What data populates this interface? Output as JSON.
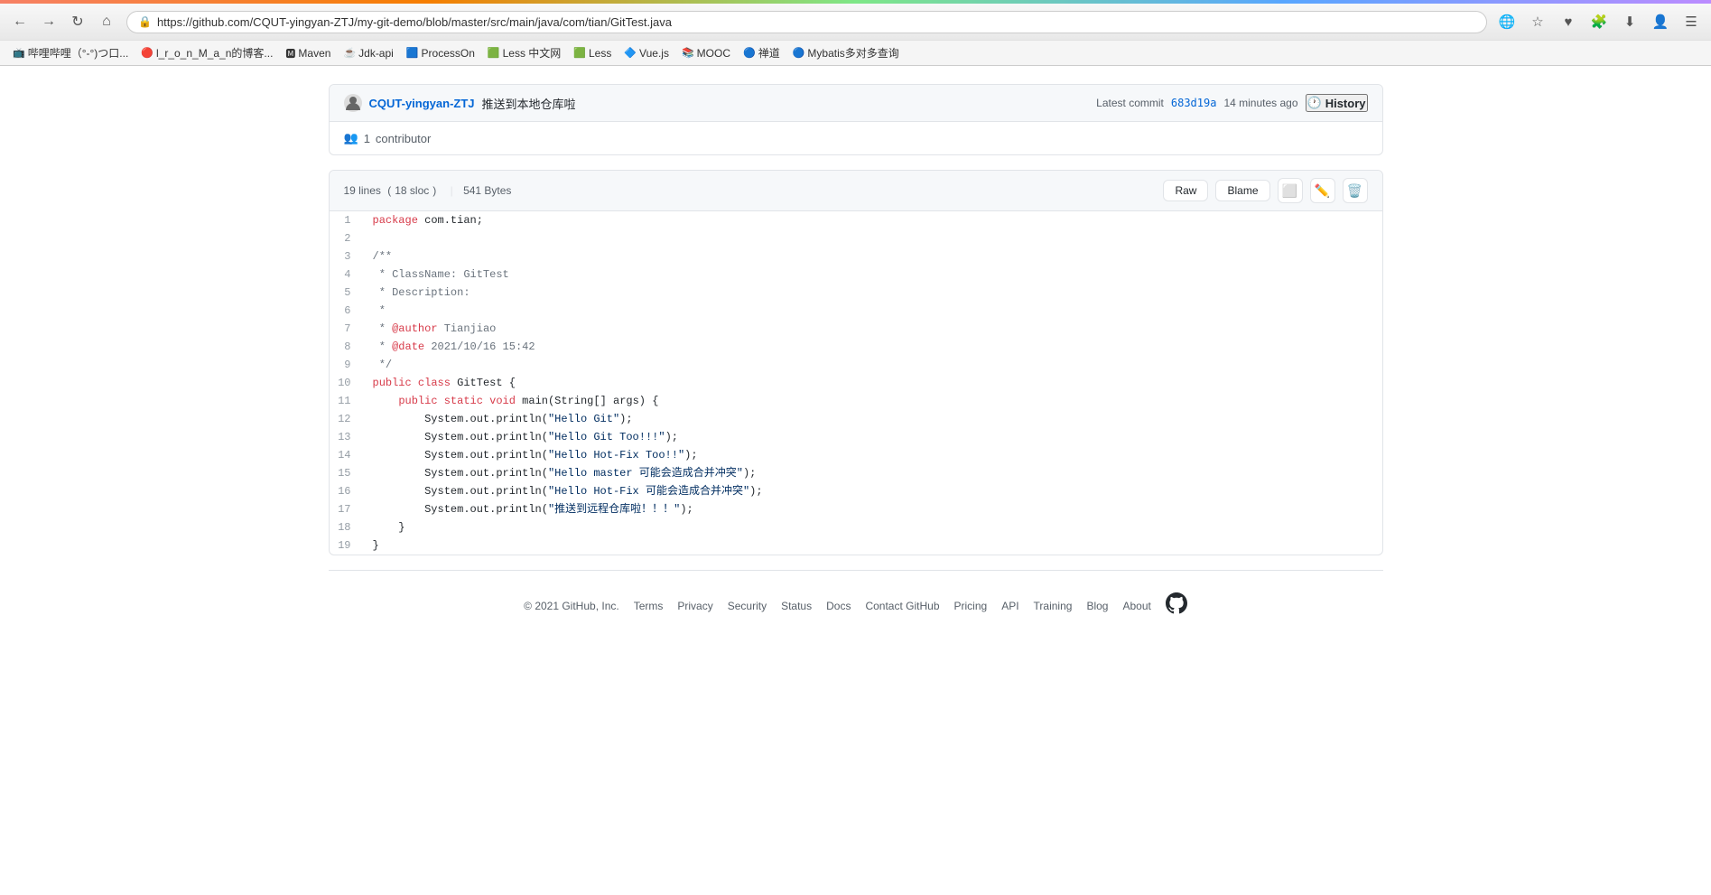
{
  "browser": {
    "url": "https://github.com/CQUT-yingyan-ZTJ/my-git-demo/blob/master/src/main/java/com/tian/GitTest.java",
    "back_disabled": false,
    "forward_disabled": false,
    "bookmarks": [
      {
        "label": "哔哩哔哩（°-°)つ口...",
        "icon": "📺"
      },
      {
        "label": "l_r_o_n_M_a_n的博客...",
        "icon": "🔴"
      },
      {
        "label": "Maven",
        "icon": "🅼"
      },
      {
        "label": "Jdk-api",
        "icon": "☕"
      },
      {
        "label": "ProcessOn",
        "icon": "🟦"
      },
      {
        "label": "Less 中文网",
        "icon": "🟩"
      },
      {
        "label": "Less",
        "icon": "🟩"
      },
      {
        "label": "Vue.js",
        "icon": "🔷"
      },
      {
        "label": "MOOC",
        "icon": "📚"
      },
      {
        "label": "禅道",
        "icon": "🔵"
      },
      {
        "label": "Mybatis多对多查询",
        "icon": "🔵"
      }
    ]
  },
  "commit_bar": {
    "username": "CQUT-yingyan-ZTJ",
    "message": "推送到本地仓库啦",
    "latest_commit_label": "Latest commit",
    "hash": "683d19a",
    "time_ago": "14 minutes ago",
    "history_label": "History"
  },
  "contributor": {
    "count": "1",
    "label": "contributor"
  },
  "code_meta": {
    "lines": "19 lines",
    "sloc": "18 sloc",
    "size": "541 Bytes"
  },
  "code_actions": {
    "raw": "Raw",
    "blame": "Blame"
  },
  "code_lines": [
    {
      "num": 1,
      "tokens": [
        {
          "t": "kw-pink",
          "v": "package"
        },
        {
          "t": "plain",
          "v": " com.tian;"
        }
      ]
    },
    {
      "num": 2,
      "tokens": []
    },
    {
      "num": 3,
      "tokens": [
        {
          "t": "cm-gray",
          "v": "/**"
        }
      ]
    },
    {
      "num": 4,
      "tokens": [
        {
          "t": "cm-gray",
          "v": " * ClassName: GitTest"
        }
      ]
    },
    {
      "num": 5,
      "tokens": [
        {
          "t": "cm-gray",
          "v": " * Description:"
        }
      ]
    },
    {
      "num": 6,
      "tokens": [
        {
          "t": "cm-gray",
          "v": " *"
        }
      ]
    },
    {
      "num": 7,
      "tokens": [
        {
          "t": "cm-gray",
          "v": " * "
        },
        {
          "t": "kw-pink",
          "v": "@author"
        },
        {
          "t": "cm-gray",
          "v": " Tianjiao"
        }
      ]
    },
    {
      "num": 8,
      "tokens": [
        {
          "t": "cm-gray",
          "v": " * "
        },
        {
          "t": "kw-pink",
          "v": "@date"
        },
        {
          "t": "cm-gray",
          "v": " 2021/10/16 15:42"
        }
      ]
    },
    {
      "num": 9,
      "tokens": [
        {
          "t": "cm-gray",
          "v": " */"
        }
      ]
    },
    {
      "num": 10,
      "tokens": [
        {
          "t": "kw-pink",
          "v": "public"
        },
        {
          "t": "plain",
          "v": " "
        },
        {
          "t": "kw-pink",
          "v": "class"
        },
        {
          "t": "plain",
          "v": " GitTest {"
        }
      ]
    },
    {
      "num": 11,
      "tokens": [
        {
          "t": "plain",
          "v": "    "
        },
        {
          "t": "kw-pink",
          "v": "public"
        },
        {
          "t": "plain",
          "v": " "
        },
        {
          "t": "kw-pink",
          "v": "static"
        },
        {
          "t": "plain",
          "v": " "
        },
        {
          "t": "kw-pink",
          "v": "void"
        },
        {
          "t": "plain",
          "v": " main(String[] args) {"
        }
      ]
    },
    {
      "num": 12,
      "tokens": [
        {
          "t": "plain",
          "v": "        System.out.println("
        },
        {
          "t": "str-blue",
          "v": "\"Hello Git\""
        },
        {
          "t": "plain",
          "v": ");"
        }
      ]
    },
    {
      "num": 13,
      "tokens": [
        {
          "t": "plain",
          "v": "        System.out.println("
        },
        {
          "t": "str-blue",
          "v": "\"Hello Git Too!!!\""
        },
        {
          "t": "plain",
          "v": ");"
        }
      ]
    },
    {
      "num": 14,
      "tokens": [
        {
          "t": "plain",
          "v": "        System.out.println("
        },
        {
          "t": "str-blue",
          "v": "\"Hello Hot-Fix Too!!\""
        },
        {
          "t": "plain",
          "v": ");"
        }
      ]
    },
    {
      "num": 15,
      "tokens": [
        {
          "t": "plain",
          "v": "        System.out.println("
        },
        {
          "t": "str-blue",
          "v": "\"Hello master 可能会造成合并冲突\""
        },
        {
          "t": "plain",
          "v": ");"
        }
      ]
    },
    {
      "num": 16,
      "tokens": [
        {
          "t": "plain",
          "v": "        System.out.println("
        },
        {
          "t": "str-blue",
          "v": "\"Hello Hot-Fix 可能会造成合并冲突\""
        },
        {
          "t": "plain",
          "v": ");"
        }
      ]
    },
    {
      "num": 17,
      "tokens": [
        {
          "t": "plain",
          "v": "        System.out.println("
        },
        {
          "t": "str-blue",
          "v": "\"推送到远程仓库啦！！！\""
        },
        {
          "t": "plain",
          "v": ");"
        }
      ]
    },
    {
      "num": 18,
      "tokens": [
        {
          "t": "plain",
          "v": "    }"
        }
      ]
    },
    {
      "num": 19,
      "tokens": [
        {
          "t": "plain",
          "v": "}"
        }
      ]
    }
  ],
  "footer": {
    "copyright": "© 2021 GitHub, Inc.",
    "links": [
      "Terms",
      "Privacy",
      "Security",
      "Status",
      "Docs",
      "Contact GitHub",
      "Pricing",
      "API",
      "Training",
      "Blog",
      "About"
    ]
  }
}
